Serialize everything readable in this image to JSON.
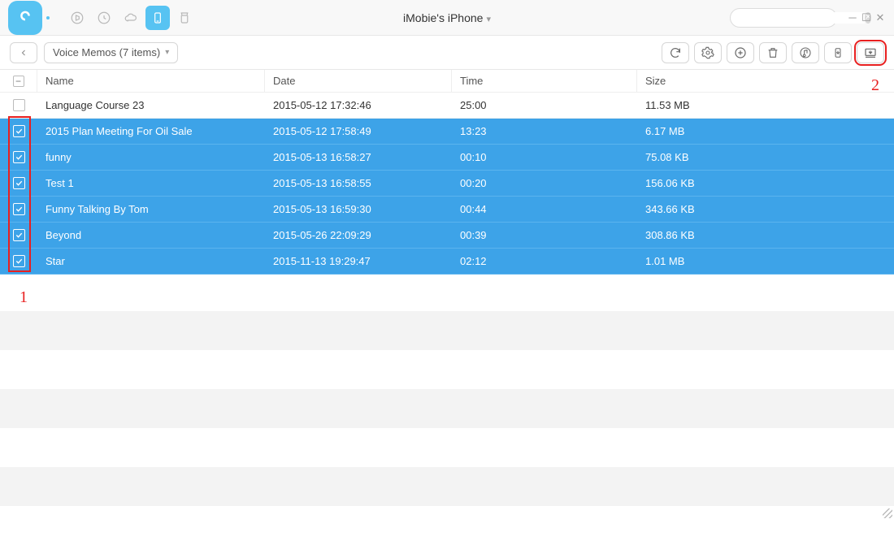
{
  "header": {
    "device_title": "iMobie's iPhone",
    "search_placeholder": ""
  },
  "toolbar": {
    "breadcrumb": "Voice Memos (7 items)"
  },
  "columns": {
    "name": "Name",
    "date": "Date",
    "time": "Time",
    "size": "Size"
  },
  "rows": [
    {
      "selected": false,
      "name": "Language Course 23",
      "date": "2015-05-12 17:32:46",
      "time": "25:00",
      "size": "11.53 MB"
    },
    {
      "selected": true,
      "name": "2015 Plan Meeting For Oil Sale",
      "date": "2015-05-12 17:58:49",
      "time": "13:23",
      "size": "6.17 MB"
    },
    {
      "selected": true,
      "name": "funny",
      "date": "2015-05-13 16:58:27",
      "time": "00:10",
      "size": "75.08 KB"
    },
    {
      "selected": true,
      "name": "Test 1",
      "date": "2015-05-13 16:58:55",
      "time": "00:20",
      "size": "156.06 KB"
    },
    {
      "selected": true,
      "name": "Funny Talking By Tom",
      "date": "2015-05-13 16:59:30",
      "time": "00:44",
      "size": "343.66 KB"
    },
    {
      "selected": true,
      "name": "Beyond",
      "date": "2015-05-26 22:09:29",
      "time": "00:39",
      "size": "308.86 KB"
    },
    {
      "selected": true,
      "name": "Star",
      "date": "2015-11-13 19:29:47",
      "time": "02:12",
      "size": "1.01 MB"
    }
  ],
  "annotations": {
    "label1": "1",
    "label2": "2"
  }
}
